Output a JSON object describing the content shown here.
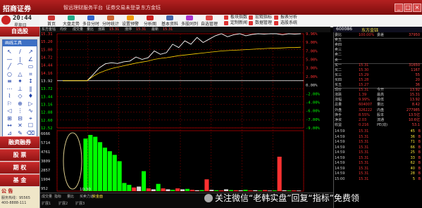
{
  "titlebar": {
    "brand": "招商证券",
    "tags": [
      "智远理财服务平台",
      "证券交易未登录",
      "东方金钰"
    ],
    "win_buttons": [
      "_",
      "□",
      "×"
    ]
  },
  "clock": {
    "time": "20:44",
    "weekday": "星期日"
  },
  "toolbar": {
    "buttons": [
      "首页",
      "大盘走势",
      "多日分时",
      "分时统计",
      "设置预警",
      "分析图",
      "基本资料",
      "多股同列",
      "自选管理"
    ],
    "panel_links": [
      "板块指数",
      "宏观指标",
      "报表分析",
      "定制新闻",
      "数据管理",
      "选股系统"
    ]
  },
  "leftbar": {
    "fav_tab": "自选股",
    "draw_tools_title": "画线工具",
    "tool_glyphs": [
      "↖",
      "/",
      "↗",
      "—",
      "|",
      "∠",
      "╱",
      "⌒",
      "▭",
      "○",
      "△",
      "⌗",
      "≡",
      "✦",
      "↕",
      "⋯",
      "⊥",
      "∥",
      "⌇",
      "◇",
      "♦",
      "⚐",
      "⊕",
      "▷",
      "◁",
      "⋮",
      "∿",
      "⊞",
      "⊟",
      "⌖",
      "↔",
      "✕",
      "☐",
      "⊿",
      "✎",
      "⌫"
    ],
    "buttons": [
      "融资融券",
      "股 票",
      "期 权",
      "基 金"
    ],
    "notice_title": "公 告",
    "notice_lines": [
      "服务热线：95565",
      "400-8888-111"
    ]
  },
  "chart_tabs": [
    "东方金钰",
    "均价",
    "成交量",
    "量比",
    "涨跌",
    "15.31",
    "涨停",
    "15.31",
    "最新",
    "15.31"
  ],
  "chart_data": [
    {
      "type": "line",
      "title": "",
      "y_left_ticks": [
        "15.31",
        "15.20",
        "15.00",
        "14.72",
        "14.44",
        "14.16",
        "13.92",
        "13.72",
        "13.44",
        "13.16",
        "12.88",
        "12.60",
        "12.52"
      ],
      "y_right_ticks": [
        "9.96%",
        "9.00%",
        "7.00%",
        "5.00%",
        "3.00%",
        "2.00%",
        "0.00%",
        "-2.00%",
        "-4.00%",
        "-6.00%",
        "-7.00%",
        "-9.00%"
      ],
      "ylim": [
        12.52,
        15.31
      ],
      "prev_close": 13.92,
      "series": [
        {
          "values": [
            13.92,
            13.92,
            13.92,
            13.92,
            13.92,
            14.1,
            14.3,
            14.42,
            14.45,
            14.43,
            14.48,
            14.5,
            14.62,
            14.55,
            14.6,
            14.8,
            14.7,
            14.75,
            15.0,
            14.9,
            15.1,
            15.0,
            15.2,
            15.05,
            15.15,
            15.25,
            15.31,
            15.22,
            15.28,
            15.31,
            15.25,
            15.29,
            15.31,
            15.3,
            15.31,
            15.31,
            15.28,
            15.31,
            15.3,
            15.31
          ]
        },
        {
          "values": [
            13.92,
            13.92,
            13.92,
            13.92,
            13.92,
            14.05,
            14.15,
            14.22,
            14.28,
            14.32,
            14.36,
            14.4,
            14.44,
            14.47,
            14.5,
            14.55,
            14.58,
            14.6,
            14.63,
            14.66,
            14.68,
            14.7,
            14.72,
            14.74,
            14.76,
            14.78,
            14.8,
            14.81,
            14.82,
            14.83,
            14.84,
            14.85,
            14.86,
            14.87,
            14.88,
            14.88,
            14.89,
            14.9,
            14.9,
            14.91
          ]
        }
      ]
    },
    {
      "type": "bar",
      "title": "",
      "y_ticks": [
        "6666",
        "5714",
        "4761",
        "3809",
        "2857",
        "1904",
        "952"
      ],
      "ylim": [
        0,
        6666
      ],
      "x_label": "10:30",
      "values": [
        0,
        0,
        0,
        0,
        0,
        5800,
        6200,
        6000,
        5400,
        4800,
        4400,
        4000,
        3300,
        900,
        700,
        400,
        500,
        2200,
        300,
        200,
        800,
        300,
        200,
        150,
        300,
        200,
        250,
        150,
        100,
        120,
        1300,
        150,
        100,
        80,
        200,
        120,
        100,
        90,
        150,
        80,
        100,
        70,
        120,
        60,
        80,
        3800,
        90,
        70,
        80,
        60
      ]
    }
  ],
  "bottom_tabs": [
    "成交量",
    "指标",
    "量比",
    "买卖力道",
    "资金面"
  ],
  "status_row": [
    "扩展1",
    "扩展2",
    "扩展3"
  ],
  "quote": {
    "code": "600086",
    "name": "东方金钰",
    "orderbook": [
      {
        "label": "委比",
        "v1": "100.00%",
        "label2": "委差",
        "v2": "37950"
      },
      {
        "label": "卖五",
        "v1": "",
        "label2": "",
        "v2": ""
      },
      {
        "label": "卖四",
        "v1": "",
        "label2": "",
        "v2": ""
      },
      {
        "label": "卖三",
        "v1": "",
        "label2": "",
        "v2": ""
      },
      {
        "label": "卖二",
        "v1": "",
        "label2": "",
        "v2": ""
      },
      {
        "label": "卖一",
        "v1": "",
        "label2": "",
        "v2": ""
      },
      {
        "label": "买一",
        "v1": "15.31",
        "label2": "",
        "v2": "31650"
      },
      {
        "label": "买二",
        "v1": "15.30",
        "label2": "",
        "v2": "1167"
      },
      {
        "label": "买三",
        "v1": "15.29",
        "label2": "",
        "v2": "55"
      },
      {
        "label": "买四",
        "v1": "15.28",
        "label2": "",
        "v2": "20"
      },
      {
        "label": "买五",
        "v1": "15.27",
        "label2": "",
        "v2": "36"
      },
      {
        "label": "现价",
        "v1": "15.31",
        "label2": "今开",
        "v2": "13.92"
      },
      {
        "label": "涨跌",
        "v1": "1.39",
        "label2": "最高",
        "v2": "15.31"
      },
      {
        "label": "涨幅",
        "v1": "9.99%",
        "label2": "最低",
        "v2": "13.92"
      },
      {
        "label": "总量",
        "v1": "604007",
        "label2": "量比",
        "v2": "8.42"
      },
      {
        "label": "外盘",
        "v1": "326222",
        "label2": "内盘",
        "v2": "277985"
      },
      {
        "label": "换手",
        "v1": "8.55%",
        "label2": "股本",
        "v2": "13.5亿"
      },
      {
        "label": "净资",
        "v1": "2.03",
        "label2": "流通",
        "v2": "10.6亿"
      },
      {
        "label": "收益",
        "v1": "0.216",
        "label2": "PE(动)",
        "v2": "53.1"
      }
    ],
    "ticks": [
      {
        "time": "14:59",
        "price": "15.31",
        "vol": "45",
        "flag": "B"
      },
      {
        "time": "14:59",
        "price": "15.31",
        "vol": "36",
        "flag": "B"
      },
      {
        "time": "14:59",
        "price": "15.31",
        "vol": "71",
        "flag": "B"
      },
      {
        "time": "14:59",
        "price": "15.31",
        "vol": "66",
        "flag": "B"
      },
      {
        "time": "14:59",
        "price": "15.31",
        "vol": "25",
        "flag": "B"
      },
      {
        "time": "14:59",
        "price": "15.31",
        "vol": "33",
        "flag": "B"
      },
      {
        "time": "14:59",
        "price": "15.31",
        "vol": "62",
        "flag": "B"
      },
      {
        "time": "14:59",
        "price": "15.31",
        "vol": "40",
        "flag": "B"
      },
      {
        "time": "14:59",
        "price": "15.31",
        "vol": "28",
        "flag": "B"
      },
      {
        "time": "15:00",
        "price": "15.31",
        "vol": "5",
        "flag": "B"
      }
    ]
  },
  "watermark": "关注微信“老韩实盘”回复“指标”免费领",
  "colors": {
    "up": "#ff3030",
    "down": "#00ff00",
    "price_line": "#ffffff",
    "avg_line": "#ffd200",
    "grid": "#7a0000"
  }
}
